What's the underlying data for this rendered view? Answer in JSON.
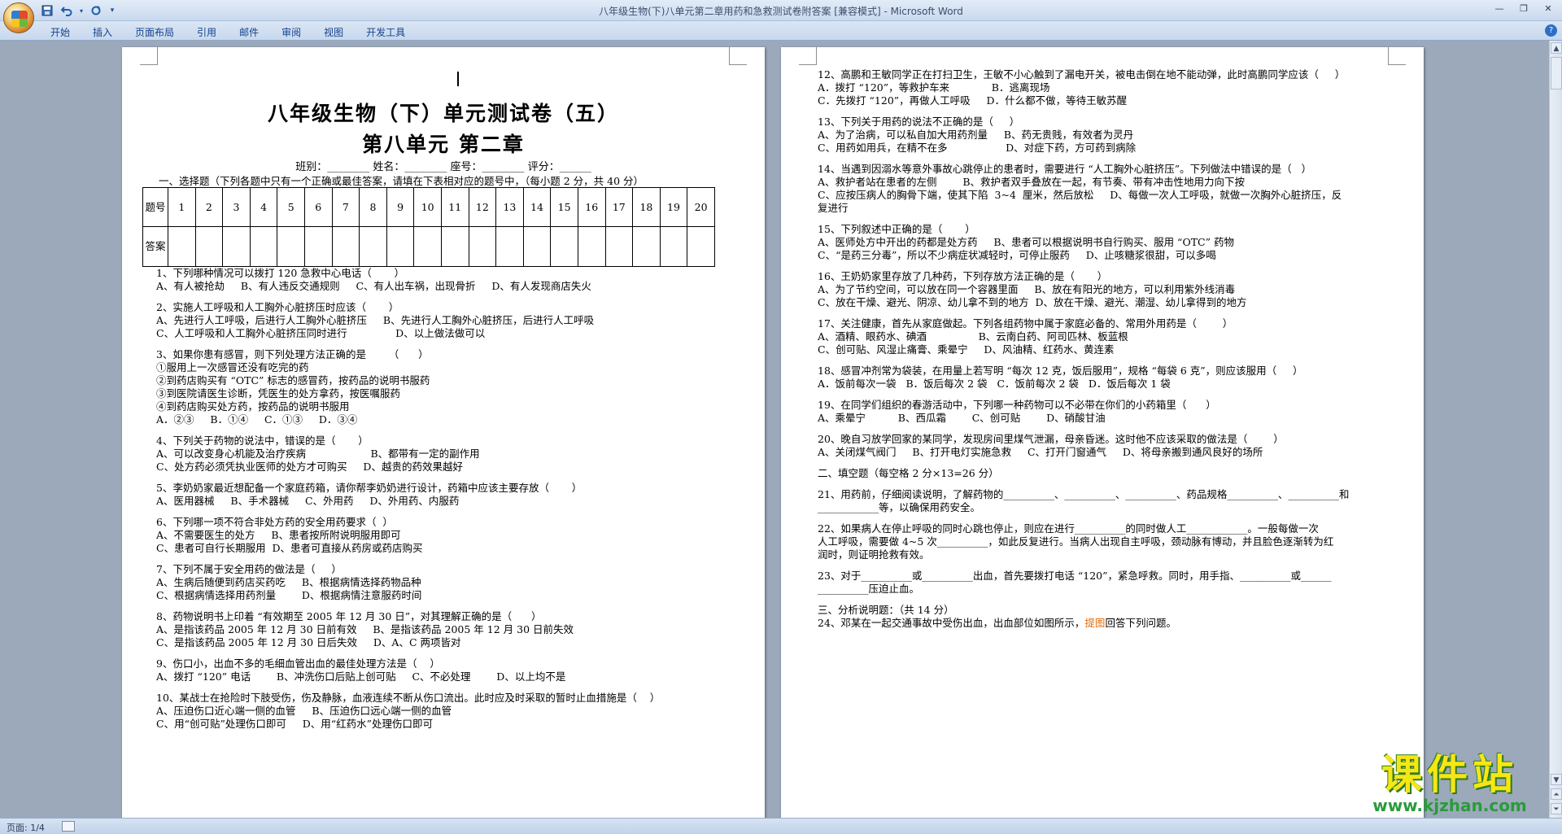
{
  "window": {
    "title": "八年级生物(下)八单元第二章用药和急救测试卷附答案 [兼容模式] - Microsoft Word"
  },
  "quick_access": {
    "save_icon": "save-icon",
    "undo_icon": "undo-icon",
    "redo_icon": "redo-icon",
    "customize_icon": "customize-icon"
  },
  "ribbon": {
    "tabs": [
      "开始",
      "插入",
      "页面布局",
      "引用",
      "邮件",
      "审阅",
      "视图",
      "开发工具"
    ]
  },
  "page1": {
    "title": "八年级生物（下）单元测试卷（五）",
    "subtitle": "第八单元  第二章",
    "info_line": "班别：________ 姓名：________ 座号：________ 评分：______",
    "section1_title": "一、选择题（下列各题中只有一个正确或最佳答案，请填在下表相对应的题号中，（每小题 2 分，共 40 分）",
    "table": {
      "row1_header": "题号",
      "row2_header": "答案",
      "numbers": [
        "1",
        "2",
        "3",
        "4",
        "5",
        "6",
        "7",
        "8",
        "9",
        "10",
        "11",
        "12",
        "13",
        "14",
        "15",
        "16",
        "17",
        "18",
        "19",
        "20"
      ]
    },
    "lines": [
      "1、下列哪种情况可以拨打 120 急救中心电话（       ）",
      "A、有人被抢劫     B、有人违反交通规则     C、有人出车祸，出现骨折     D、有人发现商店失火",
      "",
      "2、实施人工呼吸和人工胸外心脏挤压时应该（       ）",
      "A、先进行人工呼吸，后进行人工胸外心脏挤压     B、先进行人工胸外心脏挤压，后进行人工呼吸",
      "C、人工呼吸和人工胸外心脏挤压同时进行               D、以上做法做可以",
      "",
      "3、如果你患有感冒，则下列处理方法正确的是       （      ）",
      "①服用上一次感冒还没有吃完的药",
      "②到药店购买有 “OTC” 标志的感冒药，按药品的说明书服药",
      "③到医院请医生诊断，凭医生的处方拿药，按医嘱服药",
      "④到药店购买处方药，按药品的说明书服用",
      "A．②③     B．①④     C．①③     D．③④",
      "",
      "4、下列关于药物的说法中，错误的是（       ）",
      "A、可以改变身心机能及治疗疾病                    B、都带有一定的副作用",
      "C、处方药必须凭执业医师的处方才可购买     D、越贵的药效果越好",
      "",
      "5、李奶奶家最近想配备一个家庭药箱，请你帮李奶奶进行设计，药箱中应该主要存放（       ）",
      "A、医用器械     B、手术器械     C、外用药     D、外用药、内服药",
      "",
      "6、下列哪一项不符合非处方药的安全用药要求（  ）",
      "A、不需要医生的处方     B、患者按所附说明服用即可",
      "C、患者可自行长期服用  D、患者可直接从药房或药店购买",
      "",
      "7、下列不属于安全用药的做法是（     ）",
      "A、生病后随便到药店买药吃     B、根据病情选择药物品种",
      "C、根据病情选择用药剂量        D、根据病情注意服药时间",
      "",
      "8、药物说明书上印着 “有效期至 2005 年 12 月 30 日”，对其理解正确的是（      ）",
      "A、是指该药品 2005 年 12 月 30 日前有效     B、是指该药品 2005 年 12 月 30 日前失效",
      "C、是指该药品 2005 年 12 月 30 日后失效     D、A、C 两项皆对",
      "",
      "9、伤口小，出血不多的毛细血管出血的最佳处理方法是（    ）",
      "A、拨打 “120” 电话        B、冲洗伤口后贴上创可贴     C、不必处理        D、以上均不是",
      "",
      "10、某战士在抢险时下肢受伤，伤及静脉，血液连续不断从伤口流出。此时应及时采取的暂时止血措施是（    ）",
      "A、压迫伤口近心端一侧的血管     B、压迫伤口远心端一侧的血管",
      "C、用“创可贴”处理伤口即可     D、用“红药水”处理伤口即可"
    ]
  },
  "page2": {
    "lines": [
      "12、高鹏和王敏同学正在打扫卫生，王敏不小心触到了漏电开关，被电击倒在地不能动弹，此时高鹏同学应该（     ）",
      "A．拨打 “120”，等救护车来             B．逃离现场",
      "C．先拨打 “120”，再做人工呼吸     D．什么都不做，等待王敏苏醒",
      "",
      "13、下列关于用药的说法不正确的是（     ）",
      "A、为了治病，可以私自加大用药剂量     B、药无贵贱，有效者为灵丹",
      "C、用药如用兵，在精不在多                  D、对症下药，方可药到病除",
      "",
      "14、当遇到因溺水等意外事故心跳停止的患者时，需要进行 “人工胸外心脏挤压”。下列做法中错误的是（   ）",
      "A、救护者站在患者的左侧        B、救护者双手叠放在一起，有节奏、带有冲击性地用力向下按",
      "C、应按压病人的胸骨下端，使其下陷  3~4  厘米，然后放松     D、每做一次人工呼吸，就做一次胸外心脏挤压，反",
      "复进行",
      "",
      "15、下列叙述中正确的是（       ）",
      "A、医师处方中开出的药都是处方药     B、患者可以根据说明书自行购买、服用 “OTC” 药物",
      "C、“是药三分毒”，所以不少病症状减轻时，可停止服药     D、止咳糖浆很甜，可以多喝",
      "",
      "16、王奶奶家里存放了几种药，下列存放方法正确的是（       ）",
      "A、为了节约空间，可以放在同一个容器里面     B、放在有阳光的地方，可以利用紫外线消毒",
      "C、放在干燥、避光、阴凉、幼儿拿不到的地方  D、放在干燥、避光、潮湿、幼儿拿得到的地方",
      "",
      "17、关注健康，首先从家庭做起。下列各组药物中属于家庭必备的、常用外用药是（        ）",
      "A、酒精、眼药水、碘酒                B、云南白药、阿司匹林、板蓝根",
      "C、创可贴、风湿止痛膏、乘晕宁     D、风油精、红药水、黄连素",
      "",
      "18、感冒冲剂常为袋装，在用量上若写明 “每次 12 克，饭后服用”，规格 “每袋 6 克”，则应该服用（     ）",
      "A．饭前每次一袋   B．饭后每次 2 袋   C．饭前每次 2 袋   D．饭后每次 1 袋",
      "",
      "19、在同学们组织的春游活动中，下列哪一种药物可以不必带在你们的小药箱里（      ）",
      "A、乘晕宁          B、西瓜霜        C、创可贴        D、硝酸甘油",
      "",
      "20、晚自习放学回家的某同学，发现房间里煤气泄漏，母亲昏迷。这时他不应该采取的做法是（        ）",
      "A、关闭煤气阀门     B、打开电灯实施急救     C、打开门窗通气     D、将母亲搬到通风良好的场所",
      "",
      "二、填空题（每空格 2 分×13=26 分）",
      "",
      "21、用药前，仔细阅读说明，了解药物的__________、__________、__________、药品规格__________、__________和",
      "____________等，以确保用药安全。",
      "",
      "22、如果病人在停止呼吸的同时心跳也停止，则应在进行__________的同时做人工____________。一般每做一次",
      "人工呼吸，需要做 4~5 次__________，如此反复进行。当病人出现自主呼吸，颈动脉有博动，并且脸色逐渐转为红",
      "润时，则证明抢救有效。",
      "",
      "23、对于__________或__________出血，首先要拨打电话 “120”，紧急呼救。同时，用手指、__________或______",
      "__________压迫止血。",
      "",
      "三、分析说明题：（共 14 分）"
    ],
    "q24_before": "24、邓某在一起交通事故中受伤出血，出血部位如图所示，",
    "q24_highlight": "提图",
    "q24_after": "回答下列问题。"
  },
  "status": {
    "page": "页面: 1/4"
  },
  "watermark": {
    "text": "课件站",
    "url": "www.kjzhan.com"
  },
  "colors": {
    "workspace": "#9ba9bb",
    "ribbon_text": "#15428b",
    "highlight": "#e36c09"
  }
}
